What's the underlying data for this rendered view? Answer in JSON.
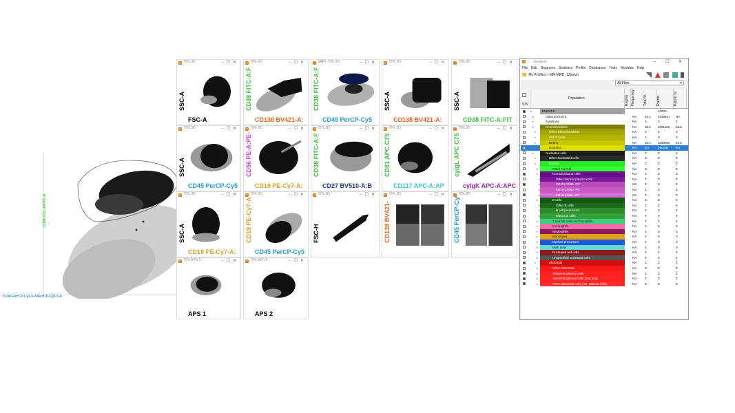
{
  "overview": {
    "xlabel": "CD45 PerCP-Cy5.5-A/PerCP-Cy5.5-A",
    "ylabel": "CD38 FITC-A/FITC-A"
  },
  "panels": [
    {
      "id": "p1",
      "title": "72% 2D",
      "xlabel": "FSC-A",
      "ylabel": "SSC-A",
      "xcolor": "#000000",
      "ycolor": "#000000"
    },
    {
      "id": "p2",
      "title": "72% 2D",
      "xlabel": "CD138 BV421-A:",
      "ylabel": "CD38 FITC-A:F",
      "xcolor": "#e8641e",
      "ycolor": "#3bc13b"
    },
    {
      "id": "p3",
      "title": "SAP5 72% 2D",
      "xlabel": "CD45 PerCP-Cy5",
      "ylabel": "CD38 FITC-A:F",
      "xcolor": "#1e9bd7",
      "ycolor": "#3bc13b"
    },
    {
      "id": "p4",
      "title": "72% 2D",
      "xlabel": "CD138 BV421-A:",
      "ylabel": "SSC-A",
      "xcolor": "#e8641e",
      "ycolor": "#000000"
    },
    {
      "id": "p5",
      "title": "72% 2D",
      "xlabel": "CD38 FITC-A:FIT",
      "ylabel": "SSC-A",
      "xcolor": "#3bc13b",
      "ycolor": "#000000"
    },
    {
      "id": "p6",
      "title": "72% 2D",
      "xlabel": "CD45 PerCP-Cy5",
      "ylabel": "SSC-A",
      "xcolor": "#1e9bd7",
      "ycolor": "#000000"
    },
    {
      "id": "p7",
      "title": "72% 2D",
      "xlabel": "CD19 PE-Cy7-A:",
      "ylabel": "CD56 PE-A:PE-",
      "xcolor": "#e0a020",
      "ycolor": "#d23fd2"
    },
    {
      "id": "p8",
      "title": "72% 2D",
      "xlabel": "CD27 BV510-A:B",
      "ylabel": "CD38 FITC-A:F",
      "xcolor": "#1a3c8c",
      "ycolor": "#3bc13b"
    },
    {
      "id": "p9",
      "title": "72% 2D",
      "xlabel": "CD117 APC-A:AP",
      "ylabel": "CD81 APC C75",
      "xcolor": "#3ac6c6",
      "ycolor": "#3bc13b"
    },
    {
      "id": "p10",
      "title": "72% 2D",
      "xlabel": "cyIgK APC-A:APC",
      "ylabel": "cyIgL APC C75",
      "xcolor": "#9c27b0",
      "ycolor": "#3bc13b"
    },
    {
      "id": "p11",
      "title": "72% 2D",
      "xlabel": "CD19 PE-Cy7-A:",
      "ylabel": "SSC-A",
      "xcolor": "#e0a020",
      "ycolor": "#000000"
    },
    {
      "id": "p12",
      "title": "72% 2D",
      "xlabel": "CD45 PerCP-Cy5",
      "ylabel": "CD19 PE-Cy7-A",
      "xcolor": "#1e9bd7",
      "ycolor": "#e0a020"
    },
    {
      "id": "p13",
      "title": "72% 2D",
      "xlabel": "",
      "ylabel": "FSC-H",
      "xcolor": "#000000",
      "ycolor": "#000000"
    },
    {
      "id": "p14",
      "title": "72% 2D",
      "xlabel": "",
      "ylabel": "CD138 BV421-",
      "xcolor": "#000000",
      "ycolor": "#e8641e"
    },
    {
      "id": "p15",
      "title": "72% 2D",
      "xlabel": "",
      "ylabel": "CD45 PerCP-Cy",
      "xcolor": "#000000",
      "ycolor": "#1e9bd7"
    },
    {
      "id": "p16",
      "title": "72% APS 9 ...",
      "xlabel": "APS 1",
      "ylabel": "",
      "xcolor": "#000000",
      "ycolor": "#000000"
    },
    {
      "id": "p17",
      "title": "72% APS 9 ...",
      "xlabel": "APS 2",
      "ylabel": "",
      "xcolor": "#000000",
      "ycolor": "#000000"
    }
  ],
  "app": {
    "title": "... - Analysis",
    "window_controls": "– ☐ ✕",
    "menu": [
      "File",
      "Edit",
      "Diagrams",
      "Statistics",
      "Profile",
      "Databases",
      "Tools",
      "Modules",
      "Help"
    ],
    "breadcrumb": "My Profiles  >  MM-MRD_12(new)",
    "filter_value": "All Files",
    "columns": {
      "vis": "VIS",
      "population": "Population",
      "region": "Region",
      "frequency": "Frequency",
      "total": "Total %",
      "events": "Events",
      "parent": "Parent %"
    }
  },
  "populations": [
    {
      "name": "EVENTS",
      "bg": "#a0a0a0",
      "fg": "#000",
      "indent": 0,
      "checked": true,
      "f": "",
      "t": "",
      "e": "10000...",
      "p": ""
    },
    {
      "name": "Other EVENTS",
      "bg": "#ffffff",
      "fg": "#000",
      "indent": 1,
      "checked": false,
      "f": "NA",
      "t": "63.4",
      "e": "6338841",
      "p": "NA"
    },
    {
      "name": "Functions",
      "bg": "#ffffff",
      "fg": "#000",
      "indent": 1,
      "checked": false,
      "f": "NA",
      "t": "0",
      "e": "0",
      "p": "0"
    },
    {
      "name": "Debris/Doublets",
      "bg": "#808000",
      "fg": "#fff",
      "indent": 1,
      "checked": false,
      "f": "NA",
      "t": "36.6",
      "e": "3661159",
      "p": "36.6"
    },
    {
      "name": "Other Debris/Doublets",
      "bg": "#a6a600",
      "fg": "#fff",
      "indent": 2,
      "checked": false,
      "f": "NA",
      "t": "0",
      "e": "0",
      "p": "0"
    },
    {
      "name": "Out of scale",
      "bg": "#b3b300",
      "fg": "#fff",
      "indent": 2,
      "checked": false,
      "f": "NA",
      "t": "0",
      "e": "0",
      "p": "0"
    },
    {
      "name": "Debris",
      "bg": "#c8c800",
      "fg": "#222",
      "indent": 2,
      "checked": false,
      "f": "NA",
      "t": "33.5",
      "e": "3350000",
      "p": "91.5"
    },
    {
      "name": "Doublets",
      "bg": "#e0e000",
      "fg": "#222",
      "indent": 2,
      "checked": false,
      "f": "NA",
      "t": "3.1",
      "e": "310000",
      "p": "8.5",
      "selected": true
    },
    {
      "name": "Nucleated cells",
      "bg": "#1a1a1a",
      "fg": "#fff",
      "indent": 1,
      "checked": false,
      "f": "NA",
      "t": "0",
      "e": "0",
      "p": "0"
    },
    {
      "name": "Other Nucleated cells",
      "bg": "#2b2b2b",
      "fg": "#fff",
      "indent": 2,
      "checked": false,
      "f": "NA",
      "t": "0",
      "e": "0",
      "p": "0"
    },
    {
      "name": "Normal",
      "bg": "#22ee22",
      "fg": "#fff",
      "indent": 2,
      "checked": false,
      "f": "NA",
      "t": "0",
      "e": "0",
      "p": "0"
    },
    {
      "name": "Other Normal",
      "bg": "#33ff33",
      "fg": "#222",
      "indent": 3,
      "checked": false,
      "f": "NA",
      "t": "0",
      "e": "0",
      "p": "0"
    },
    {
      "name": "Normal plasma cells",
      "bg": "#6a0d8c",
      "fg": "#fff",
      "indent": 3,
      "checked": true,
      "f": "NA",
      "t": "0",
      "e": "0",
      "p": "0"
    },
    {
      "name": "Other Normal plasma cells",
      "bg": "#7a1a9c",
      "fg": "#fff",
      "indent": 4,
      "checked": false,
      "f": "NA",
      "t": "0",
      "e": "0",
      "p": "0"
    },
    {
      "name": "CD19+CD56- PC",
      "bg": "#b84bb8",
      "fg": "#fff",
      "indent": 4,
      "checked": true,
      "f": "NA",
      "t": "0",
      "e": "0",
      "p": "0"
    },
    {
      "name": "CD19-CD56+ PC",
      "bg": "#c85ac8",
      "fg": "#fff",
      "indent": 4,
      "checked": false,
      "f": "NA",
      "t": "0",
      "e": "0",
      "p": "0"
    },
    {
      "name": "CD19-CD56- PC",
      "bg": "#d66ad6",
      "fg": "#fff",
      "indent": 4,
      "checked": true,
      "f": "NA",
      "t": "0",
      "e": "0",
      "p": "0"
    },
    {
      "name": "B cells",
      "bg": "#0f5c0f",
      "fg": "#fff",
      "indent": 3,
      "checked": false,
      "f": "NA",
      "t": "0",
      "e": "0",
      "p": "0"
    },
    {
      "name": "Other B cells",
      "bg": "#1a6b1a",
      "fg": "#fff",
      "indent": 4,
      "checked": false,
      "f": "NA",
      "t": "0",
      "e": "0",
      "p": "0"
    },
    {
      "name": "B cell precursors",
      "bg": "#2e8b2e",
      "fg": "#fff",
      "indent": 4,
      "checked": false,
      "f": "NA",
      "t": "0",
      "e": "0",
      "p": "0"
    },
    {
      "name": "Mature B cells",
      "bg": "#38a038",
      "fg": "#fff",
      "indent": 4,
      "checked": false,
      "f": "NA",
      "t": "0",
      "e": "0",
      "p": "0"
    },
    {
      "name": "T and NK cells and basophils",
      "bg": "#3ad07a",
      "fg": "#222",
      "indent": 3,
      "checked": false,
      "f": "NA",
      "t": "0",
      "e": "0",
      "p": "0"
    },
    {
      "name": "Eosinophils",
      "bg": "#f06aa8",
      "fg": "#222",
      "indent": 3,
      "checked": false,
      "f": "NA",
      "t": "0",
      "e": "0",
      "p": "0"
    },
    {
      "name": "Neutrophils",
      "bg": "#8a1a5a",
      "fg": "#fff",
      "indent": 3,
      "checked": false,
      "f": "NA",
      "t": "0",
      "e": "0",
      "p": "0"
    },
    {
      "name": "Monocytes",
      "bg": "#e0a020",
      "fg": "#222",
      "indent": 3,
      "checked": false,
      "f": "NA",
      "t": "0",
      "e": "0",
      "p": "0"
    },
    {
      "name": "Myeloid precursors",
      "bg": "#1e5ad7",
      "fg": "#fff",
      "indent": 3,
      "checked": false,
      "f": "NA",
      "t": "0",
      "e": "0",
      "p": "0"
    },
    {
      "name": "Mast cells",
      "bg": "#6ad7d7",
      "fg": "#222",
      "indent": 3,
      "checked": false,
      "f": "NA",
      "t": "0",
      "e": "0",
      "p": "0"
    },
    {
      "name": "Nucleated red cells",
      "bg": "#8b1a1a",
      "fg": "#fff",
      "indent": 3,
      "checked": false,
      "f": "NA",
      "t": "0",
      "e": "0",
      "p": "0"
    },
    {
      "name": "Unspecified nucleated cells",
      "bg": "#555555",
      "fg": "#fff",
      "indent": 3,
      "checked": false,
      "f": "NA",
      "t": "0",
      "e": "0",
      "p": "0"
    },
    {
      "name": "Abnormal",
      "bg": "#d01010",
      "fg": "#fff",
      "indent": 2,
      "checked": true,
      "f": "NA",
      "t": "0",
      "e": "0",
      "p": "0"
    },
    {
      "name": "Other Abnormal",
      "bg": "#ff1a1a",
      "fg": "#fff",
      "indent": 3,
      "checked": false,
      "f": "NA",
      "t": "0",
      "e": "0",
      "p": "0"
    },
    {
      "name": "Abnormal plasma cells",
      "bg": "#ff2020",
      "fg": "#fff",
      "indent": 3,
      "checked": true,
      "f": "NA",
      "t": "0",
      "e": "0",
      "p": "0"
    },
    {
      "name": "Abnormal plasma cells (2nd pop)",
      "bg": "#ff2424",
      "fg": "#fff",
      "indent": 3,
      "checked": true,
      "f": "NA",
      "t": "0",
      "e": "0",
      "p": "0"
    },
    {
      "name": "Other abnormal cells (non plasma cells)",
      "bg": "#ff2828",
      "fg": "#fff",
      "indent": 3,
      "checked": true,
      "f": "NA",
      "t": "0",
      "e": "0",
      "p": "0"
    }
  ]
}
